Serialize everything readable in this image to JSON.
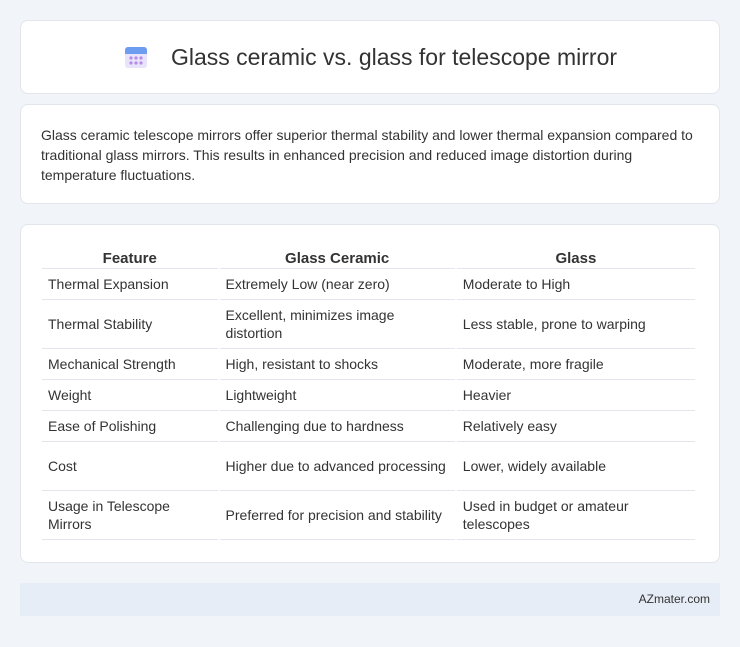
{
  "title": "Glass ceramic vs. glass for telescope mirror",
  "description": "Glass ceramic telescope mirrors offer superior thermal stability and lower thermal expansion compared to traditional glass mirrors. This results in enhanced precision and reduced image distortion during temperature fluctuations.",
  "table": {
    "headers": [
      "Feature",
      "Glass Ceramic",
      "Glass"
    ],
    "rows": [
      [
        "Thermal Expansion",
        "Extremely Low (near zero)",
        "Moderate to High"
      ],
      [
        "Thermal Stability",
        "Excellent, minimizes image distortion",
        "Less stable, prone to warping"
      ],
      [
        "Mechanical Strength",
        "High, resistant to shocks",
        "Moderate, more fragile"
      ],
      [
        "Weight",
        "Lightweight",
        "Heavier"
      ],
      [
        "Ease of Polishing",
        "Challenging due to hardness",
        "Relatively easy"
      ],
      [
        "Cost",
        "Higher due to advanced processing",
        "Lower, widely available"
      ],
      [
        "Usage in Telescope Mirrors",
        "Preferred for precision and stability",
        "Used in budget or amateur telescopes"
      ]
    ]
  },
  "footer": {
    "brand": "AZmater.com"
  },
  "icons": {
    "title_icon": "calendar-icon"
  },
  "colors": {
    "background": "#f1f4f8",
    "footer_bg": "#e6edf6",
    "icon_blue": "#5b8def",
    "icon_purple": "#b58de6"
  }
}
